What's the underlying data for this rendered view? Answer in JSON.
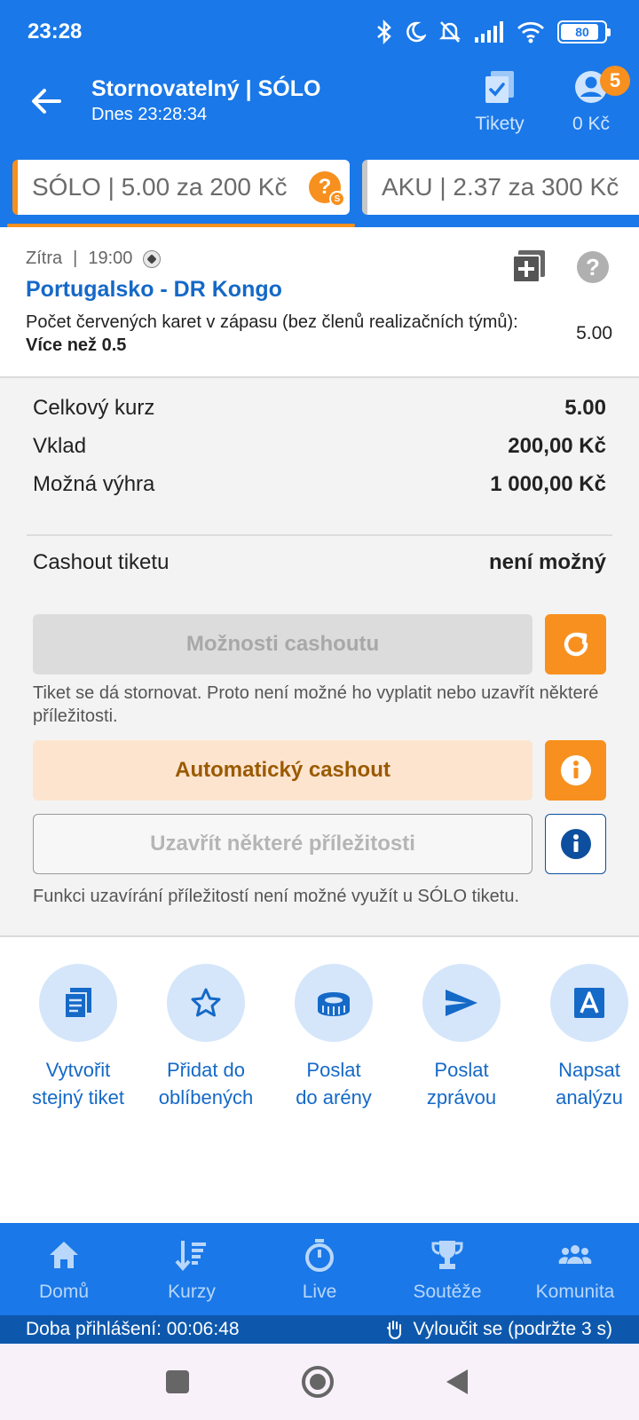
{
  "status_bar": {
    "time": "23:28",
    "battery": "80"
  },
  "header": {
    "title": "Stornovatelný | SÓLO",
    "subtitle": "Dnes 23:28:34",
    "tikety_label": "Tikety",
    "balance": "0 Kč",
    "notification_count": "5"
  },
  "ticket_tabs": [
    {
      "label": "SÓLO  | 5.00 za 200 Kč",
      "active": true
    },
    {
      "label": "AKU  | 2.37 za 300 Kč",
      "active": false
    }
  ],
  "event": {
    "date": "Zítra",
    "time": "19:00",
    "teams": "Portugalsko - DR Kongo",
    "market": "Počet červených karet v zápasu (bez členů realizačních týmů):",
    "selection": "Více než 0.5",
    "odd": "5.00"
  },
  "summary": {
    "total_odds_label": "Celkový kurz",
    "total_odds_value": "5.00",
    "stake_label": "Vklad",
    "stake_value": "200,00 Kč",
    "win_label": "Možná výhra",
    "win_value": "1 000,00 Kč",
    "cashout_label": "Cashout tiketu",
    "cashout_value": "není možný"
  },
  "cashout": {
    "options_button": "Možnosti cashoutu",
    "storno_note": "Tiket se dá stornovat. Proto není možné ho vyplatit nebo uzavřít některé příležitosti.",
    "auto_button": "Automatický cashout",
    "close_button": "Uzavřít některé příležitosti",
    "solo_note": "Funkci uzavírání příležitostí není možné využít u SÓLO tiketu."
  },
  "actions": [
    {
      "line1": "Vytvořit",
      "line2": "stejný tiket",
      "icon": "ticket-copy-icon"
    },
    {
      "line1": "Přidat do",
      "line2": "oblíbených",
      "icon": "star-icon"
    },
    {
      "line1": "Poslat",
      "line2": "do arény",
      "icon": "arena-icon"
    },
    {
      "line1": "Poslat",
      "line2": "zprávou",
      "icon": "send-icon"
    },
    {
      "line1": "Napsat",
      "line2": "analýzu",
      "icon": "analysis-icon"
    }
  ],
  "bottom_nav": [
    {
      "label": "Domů",
      "icon": "home-icon"
    },
    {
      "label": "Kurzy",
      "icon": "odds-icon"
    },
    {
      "label": "Live",
      "icon": "stopwatch-icon"
    },
    {
      "label": "Soutěže",
      "icon": "trophy-icon"
    },
    {
      "label": "Komunita",
      "icon": "community-icon"
    }
  ],
  "login_bar": {
    "session": "Doba přihlášení: 00:06:48",
    "exclude": "Vyloučit se (podržte 3 s)"
  },
  "colors": {
    "brand_blue": "#1a78e8",
    "accent_orange": "#f7901e",
    "link_blue": "#1569c7"
  }
}
